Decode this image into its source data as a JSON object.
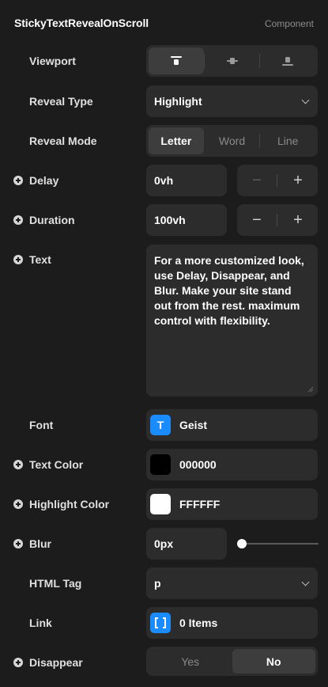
{
  "header": {
    "title": "StickyTextRevealOnScroll",
    "type_tag": "Component"
  },
  "viewport": {
    "label": "Viewport",
    "options": [
      "align-top-icon",
      "align-center-icon",
      "align-bottom-icon"
    ],
    "selected": 0
  },
  "reveal_type": {
    "label": "Reveal Type",
    "value": "Highlight"
  },
  "reveal_mode": {
    "label": "Reveal Mode",
    "options": [
      "Letter",
      "Word",
      "Line"
    ],
    "selected": "Letter"
  },
  "delay": {
    "label": "Delay",
    "value": "0vh",
    "minus": "−",
    "plus": "+"
  },
  "duration": {
    "label": "Duration",
    "value": "100vh",
    "minus": "−",
    "plus": "+"
  },
  "text": {
    "label": "Text",
    "value": "For a more customized look, use Delay, Disappear, and Blur. Make your site stand out from the rest. maximum control with flexibility."
  },
  "font": {
    "label": "Font",
    "value": "Geist",
    "icon_glyph": "T",
    "icon_color": "#1a8cff"
  },
  "text_color": {
    "label": "Text Color",
    "value": "000000",
    "swatch": "#000000"
  },
  "highlight_color": {
    "label": "Highlight Color",
    "value": "FFFFFF",
    "swatch": "#FFFFFF"
  },
  "blur": {
    "label": "Blur",
    "value": "0px",
    "level": 0
  },
  "html_tag": {
    "label": "HTML Tag",
    "value": "p"
  },
  "link": {
    "label": "Link",
    "value": "0 Items",
    "icon_glyph": "[ ]",
    "icon_color": "#1a8cff"
  },
  "disappear": {
    "label": "Disappear",
    "options": [
      "Yes",
      "No"
    ],
    "selected": "No"
  }
}
